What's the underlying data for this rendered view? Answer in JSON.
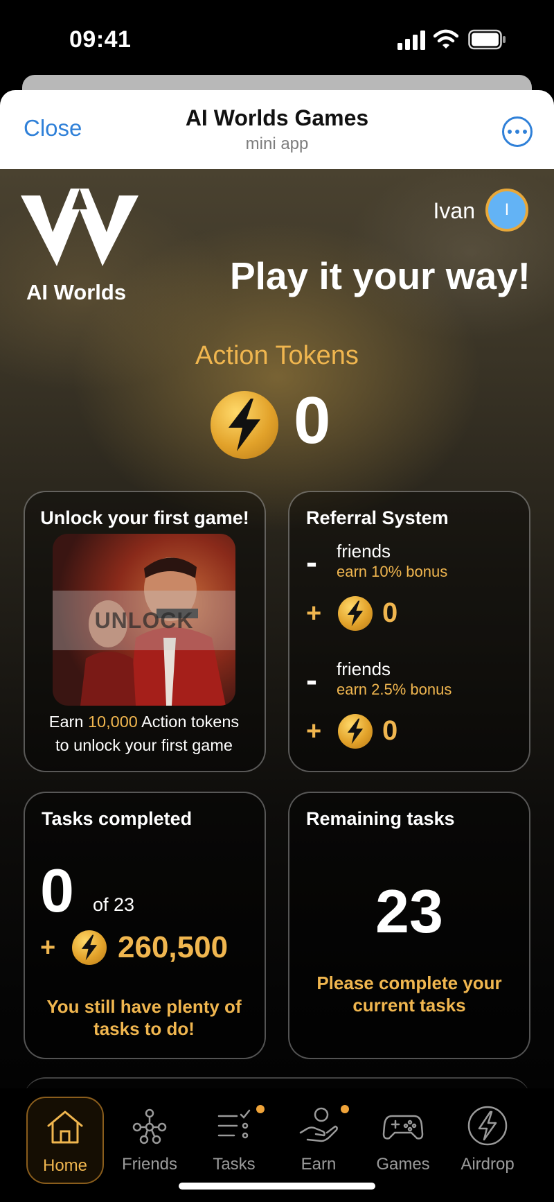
{
  "status": {
    "time": "09:41"
  },
  "header": {
    "close_label": "Close",
    "title": "AI Worlds Games",
    "subtitle": "mini app"
  },
  "hero": {
    "logo_text": "AI Worlds",
    "user_name": "Ivan",
    "avatar_initial": "I",
    "headline": "Play it your way!",
    "tokens_label": "Action Tokens",
    "tokens_value": "0"
  },
  "unlock_card": {
    "title": "Unlock your first game!",
    "overlay_text": "UNLOCK",
    "earn_prefix": "Earn ",
    "earn_amount": "10,000",
    "earn_suffix": " Action tokens",
    "earn_line2": "to unlock your first game"
  },
  "referral_card": {
    "title": "Referral System",
    "tiers": [
      {
        "count": "-",
        "friends": "friends",
        "bonus": "earn 10% bonus",
        "plus": "+",
        "value": "0"
      },
      {
        "count": "-",
        "friends": "friends",
        "bonus": "earn 2.5% bonus",
        "plus": "+",
        "value": "0"
      }
    ]
  },
  "tasks_card": {
    "title": "Tasks completed",
    "completed": "0",
    "of_total": "of 23",
    "plus": "+",
    "reward": "260,500",
    "message": "You still have plenty of tasks to do!"
  },
  "remaining_card": {
    "title": "Remaining tasks",
    "value": "23",
    "message": "Please complete your current tasks"
  },
  "tabs": [
    {
      "label": "Home",
      "icon": "home-icon",
      "active": true
    },
    {
      "label": "Friends",
      "icon": "network-icon"
    },
    {
      "label": "Tasks",
      "icon": "checklist-icon",
      "badge": true
    },
    {
      "label": "Earn",
      "icon": "hand-coin-icon",
      "badge": true
    },
    {
      "label": "Games",
      "icon": "gamepad-icon"
    },
    {
      "label": "Airdrop",
      "icon": "lightning-icon"
    }
  ],
  "colors": {
    "accent": "#f0b64f",
    "link": "#2f80d8",
    "avatar": "#63b3f5"
  }
}
